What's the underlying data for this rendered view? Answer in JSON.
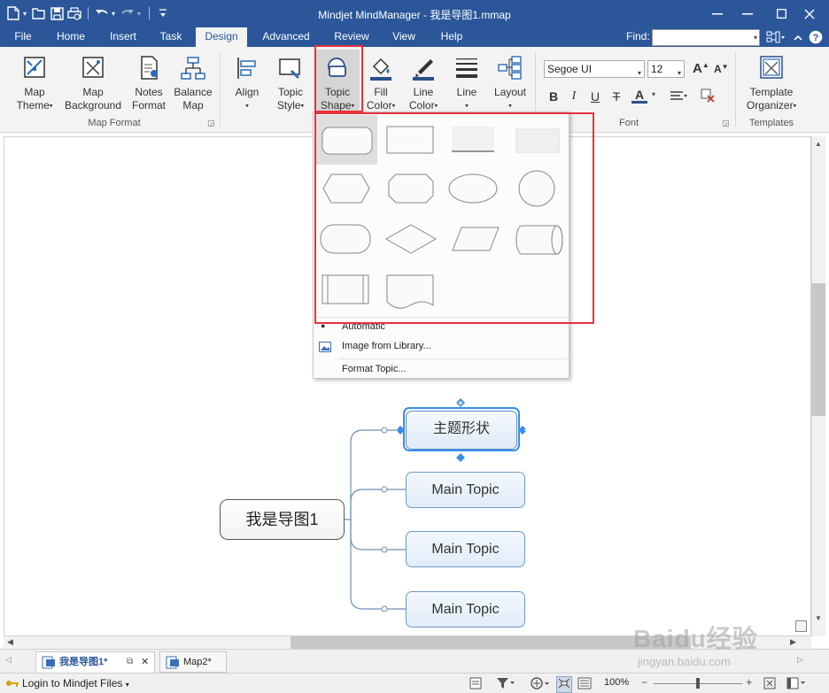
{
  "window": {
    "title": "Mindjet MindManager - 我是导图1.mmap"
  },
  "ribbon_tabs": [
    {
      "label": "File"
    },
    {
      "label": "Home"
    },
    {
      "label": "Insert"
    },
    {
      "label": "Task"
    },
    {
      "label": "Design"
    },
    {
      "label": "Advanced"
    },
    {
      "label": "Review"
    },
    {
      "label": "View"
    },
    {
      "label": "Help"
    }
  ],
  "active_tab": "Design",
  "find": {
    "label": "Find:",
    "value": ""
  },
  "ribbon": {
    "map_format": {
      "group_label": "Map Format",
      "buttons": [
        {
          "line1": "Map",
          "line2": "Theme",
          "icon": "map-theme-icon"
        },
        {
          "line1": "Map",
          "line2": "Background",
          "icon": "map-background-icon"
        },
        {
          "line1": "Notes",
          "line2": "Format",
          "icon": "notes-format-icon"
        },
        {
          "line1": "Balance",
          "line2": "Map",
          "icon": "balance-map-icon"
        }
      ]
    },
    "topic_format": {
      "buttons": [
        {
          "line1": "Align",
          "line2": "",
          "icon": "align-icon"
        },
        {
          "line1": "Topic",
          "line2": "Style",
          "icon": "topic-style-icon"
        },
        {
          "line1": "Topic",
          "line2": "Shape",
          "icon": "topic-shape-icon"
        },
        {
          "line1": "Fill",
          "line2": "Color",
          "icon": "fill-color-icon"
        },
        {
          "line1": "Line",
          "line2": "Color",
          "icon": "line-color-icon"
        },
        {
          "line1": "Line",
          "line2": "",
          "icon": "line-icon"
        },
        {
          "line1": "Layout",
          "line2": "",
          "icon": "layout-icon"
        }
      ]
    },
    "font": {
      "group_label": "Font",
      "family": "Segoe UI",
      "size": "12",
      "grow_label": "A",
      "shrink_label": "A",
      "bold": "B",
      "italic": "I",
      "underline": "U",
      "strike": "T",
      "color_letter": "A"
    },
    "templates": {
      "group_label": "Templates",
      "button": {
        "line1": "Template",
        "line2": "Organizer",
        "icon": "template-organizer-icon"
      }
    }
  },
  "dropdown": {
    "shapes": [
      "rounded-rectangle",
      "rectangle",
      "line",
      "plain",
      "hexagon",
      "octagon",
      "ellipse",
      "circle",
      "capsule",
      "diamond",
      "parallelogram",
      "cylinder",
      "subroutine",
      "document"
    ],
    "menu_items": [
      {
        "label": "Automatic",
        "icon": "bullet-icon"
      },
      {
        "label": "Image from Library...",
        "icon": "image-library-icon"
      },
      {
        "label": "Format Topic...",
        "icon": ""
      }
    ]
  },
  "map": {
    "central_topic": "我是导图1",
    "topics": [
      "主题形状",
      "Main Topic",
      "Main Topic",
      "Main Topic"
    ]
  },
  "document_tabs": [
    {
      "label": "我是导图1*",
      "active": true
    },
    {
      "label": "Map2*",
      "active": false
    }
  ],
  "status": {
    "login": "Login to Mindjet Files",
    "zoom": "100%"
  },
  "watermark": {
    "line1": "Baidu经验",
    "line2": "jingyan.baidu.com"
  },
  "colors": {
    "titlebar": "#2b579a",
    "highlight_red": "#e8323a",
    "selection_blue": "#3a8ee6"
  }
}
